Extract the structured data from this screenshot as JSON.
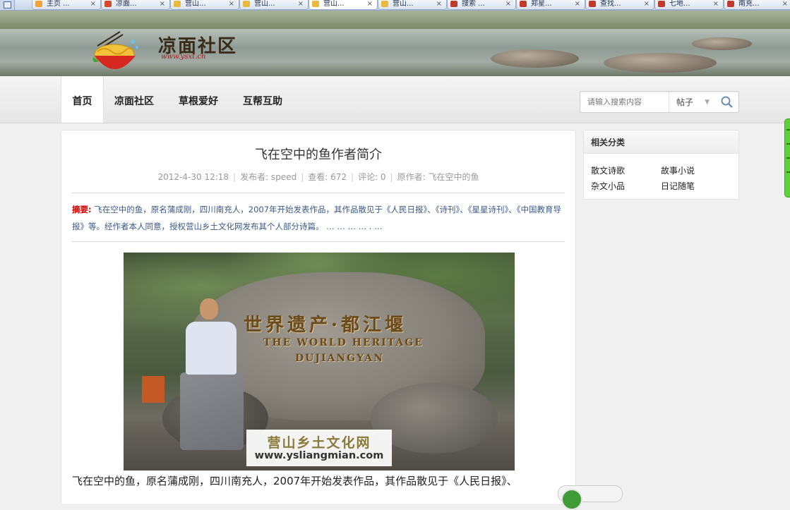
{
  "browser": {
    "tabs": [
      {
        "label": "主页 ...",
        "icon_color": "#f2a43a",
        "active": false
      },
      {
        "label": "凉面...",
        "icon_color": "#d44a2a",
        "active": false
      },
      {
        "label": "营山...",
        "icon_color": "#e8b93a",
        "active": false
      },
      {
        "label": "营山...",
        "icon_color": "#e8b93a",
        "active": false
      },
      {
        "label": "营山...",
        "icon_color": "#e8b93a",
        "active": true
      },
      {
        "label": "营山...",
        "icon_color": "#e8b93a",
        "active": false
      },
      {
        "label": "搜索 ...",
        "icon_color": "#c0392b",
        "active": false
      },
      {
        "label": "郑星...",
        "icon_color": "#c0392b",
        "active": false
      },
      {
        "label": "查找...",
        "icon_color": "#c0392b",
        "active": false
      },
      {
        "label": "七地...",
        "icon_color": "#c0392b",
        "active": false
      },
      {
        "label": "南充...",
        "icon_color": "#c0392b",
        "active": false
      }
    ],
    "close_glyph": "×"
  },
  "site": {
    "name": "凉面社区",
    "url": "www.ysxt.cn"
  },
  "nav": {
    "items": [
      "首页",
      "凉面社区",
      "草根爱好",
      "互帮互助"
    ],
    "active_index": 0
  },
  "search": {
    "placeholder": "请输入搜索内容",
    "type_selected": "帖子",
    "caret": "▼"
  },
  "article": {
    "title": "飞在空中的鱼作者简介",
    "date": "2012-4-30 12:18",
    "author": "发布者: speed",
    "views": "查看: 672",
    "comments": "评论: 0",
    "original_author": "原作者: 飞在空中的鱼",
    "summary_label": "摘要:",
    "summary_text": "飞在空中的鱼，原名蒲成刚，四川南充人，2007年开始发表作品，其作品散见于《人民日报》、《诗刊》、《星星诗刊》、《中国教育导报》等。经作者本人同意，授权营山乡土文化网发布其个人部分诗篇。 … … … … . …",
    "photo": {
      "stone_cn": "世界遗产·都江堰",
      "stone_en_line1": "THE WORLD HERITAGE",
      "stone_en_line2": "DUJIANGYAN",
      "watermark_cn": "营山乡土文化网",
      "watermark_url": "www.ysliangmian.com"
    },
    "body_first_line": "飞在空中的鱼，原名蒲成刚，四川南充人，2007年开始发表作品，其作品散见于《人民日报》、"
  },
  "sidebar": {
    "title": "相关分类",
    "links": [
      "散文诗歌",
      "故事小说",
      "杂文小品",
      "日记随笔"
    ]
  },
  "colors": {
    "summary_label": "#cc0000",
    "summary_text": "#3a5a8a",
    "right_toolbar": "#5fd13a"
  }
}
